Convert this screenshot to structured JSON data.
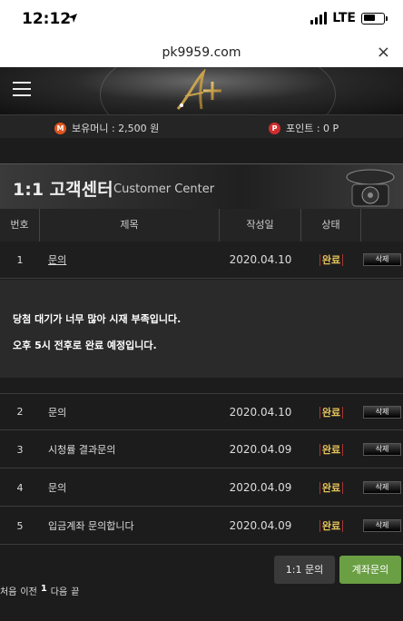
{
  "status_bar": {
    "time": "12:12",
    "network": "LTE"
  },
  "browser": {
    "url": "pk9959.com",
    "close": "×"
  },
  "wallet": {
    "money_label": "보유머니 : 2,500 원",
    "points_label": "포인트 : 0 P",
    "money_icon": "M",
    "points_icon": "P"
  },
  "banner": {
    "title": "1:1 고객센터",
    "subtitle": "Customer Center"
  },
  "table": {
    "headers": {
      "no": "번호",
      "subject": "제목",
      "date": "작성일",
      "status": "상태"
    },
    "rows": [
      {
        "no": "1",
        "subject": "문의",
        "date": "2020.04.10",
        "status": "완료",
        "delete": "삭제"
      },
      {
        "no": "2",
        "subject": "문의",
        "date": "2020.04.10",
        "status": "완료",
        "delete": "삭제"
      },
      {
        "no": "3",
        "subject": "시청률 결과문의",
        "date": "2020.04.09",
        "status": "완료",
        "delete": "삭제"
      },
      {
        "no": "4",
        "subject": "문의",
        "date": "2020.04.09",
        "status": "완료",
        "delete": "삭제"
      },
      {
        "no": "5",
        "subject": "입금계좌 문의합니다",
        "date": "2020.04.09",
        "status": "완료",
        "delete": "삭제"
      }
    ]
  },
  "answer": {
    "line1": "당첨 대기가 너무 많아 시재 부족입니다.",
    "line2": "오후 5시 전후로 완료 예정입니다."
  },
  "buttons": {
    "inquiry": "1:1 문의",
    "account": "계좌문의"
  },
  "pager": {
    "first": "처음",
    "prev": "이전",
    "current": "1",
    "next": "다음",
    "last": "끝"
  }
}
